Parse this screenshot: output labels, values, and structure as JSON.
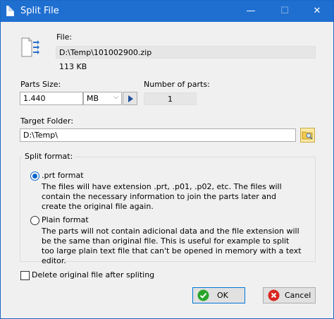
{
  "window": {
    "title": "Split File",
    "minimize_glyph": "—",
    "maximize_glyph": "☐",
    "close_glyph": "✕"
  },
  "file": {
    "label": "File:",
    "path": "D:\\Temp\\101002900.zip",
    "size": "113 KB",
    "icon": "split-file-icon"
  },
  "parts": {
    "size_label": "Parts Size:",
    "size_value": "1.440",
    "unit_value": "MB",
    "count_label": "Number of parts:",
    "count_value": "1"
  },
  "target": {
    "label": "Target Folder:",
    "path": "D:\\Temp\\",
    "browse_icon": "folder-search-icon"
  },
  "split_format": {
    "legend": "Split format:",
    "prt": {
      "label": ".prt format",
      "selected": true,
      "description": "The files will have extension .prt, .p01, .p02, etc. The files will contain the necessary information to join the parts later and create the original file again."
    },
    "plain": {
      "label": "Plain format",
      "selected": false,
      "description": "The parts will not contain adicional data and the file extension will be the same than original file. This is useful for example to split too large plain text file that can't be opened in memory with a text editor."
    }
  },
  "delete_original": {
    "label": "Delete original file after spliting",
    "checked": false
  },
  "buttons": {
    "ok": "OK",
    "cancel": "Cancel"
  },
  "colors": {
    "titlebar": "#1f6fd1",
    "accent": "#0a64c8",
    "ok_icon": "#2aa52a",
    "cancel_icon": "#d8261f"
  }
}
